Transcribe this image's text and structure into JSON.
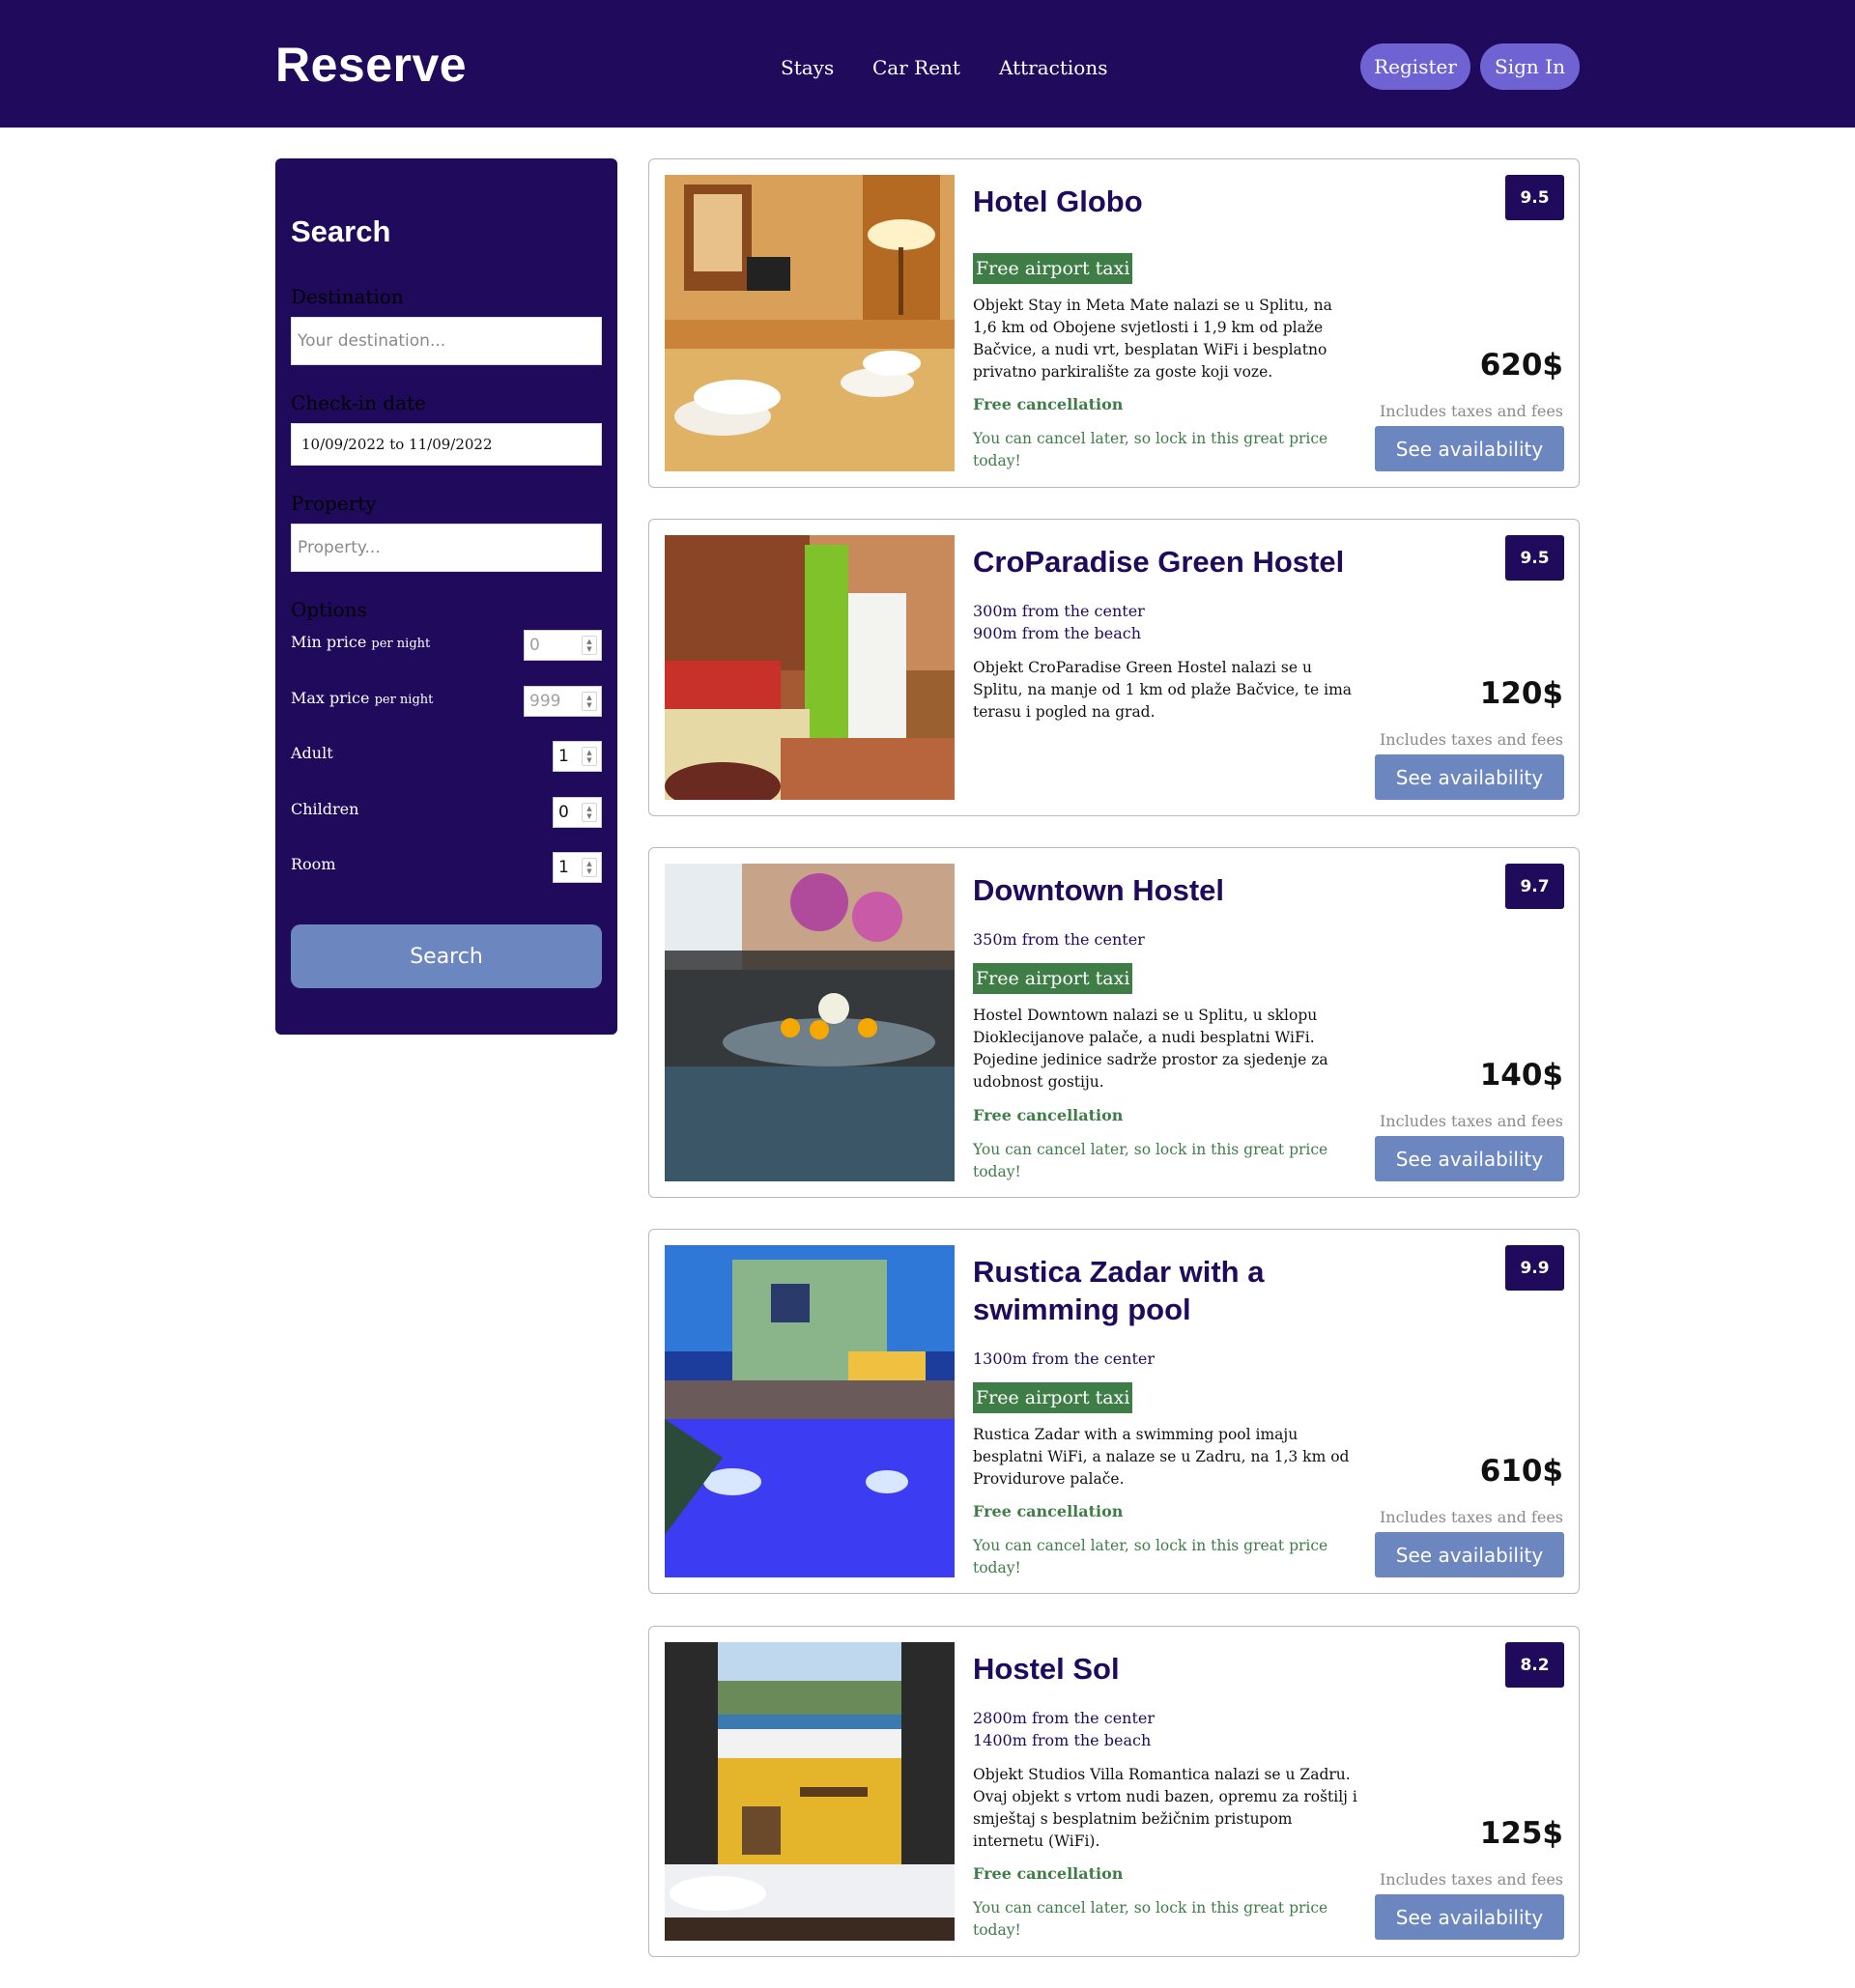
{
  "header": {
    "logo": "Reserve",
    "nav": [
      "Stays",
      "Car Rent",
      "Attractions"
    ],
    "register": "Register",
    "sign_in": "Sign In"
  },
  "sidebar": {
    "title": "Search",
    "destination_label": "Destination",
    "destination_placeholder": "Your destination...",
    "checkin_label": "Check-in date",
    "checkin_value": "10/09/2022 to 11/09/2022",
    "property_label": "Property",
    "property_placeholder": "Property...",
    "options_label": "Options",
    "min_price_label": "Min price",
    "min_price_suffix": "per night",
    "min_price_placeholder": "0",
    "max_price_label": "Max price",
    "max_price_suffix": "per night",
    "max_price_placeholder": "999",
    "adult_label": "Adult",
    "adult_value": "1",
    "children_label": "Children",
    "children_value": "0",
    "room_label": "Room",
    "room_value": "1",
    "search_button": "Search"
  },
  "results": [
    {
      "title": "Hotel Globo",
      "distance_center": "",
      "distance_beach": "",
      "taxi": "Free airport taxi",
      "description": "Objekt Stay in Meta Mate nalazi se u Splitu, na 1,6 km od Obojene svjetlosti i 1,9 km od plaže Bačvice, a nudi vrt, besplatan WiFi i besplatno privatno parkiralište za goste koji voze.",
      "free_cancellation": "Free cancellation",
      "cancel_note": "You can cancel later, so lock in this great price today!",
      "rating": "9.5",
      "price": "620$",
      "taxes": "Includes taxes and fees",
      "button": "See availability"
    },
    {
      "title": "CroParadise Green Hostel",
      "distance_center": "300m from the center",
      "distance_beach": "900m from the beach",
      "taxi": "",
      "description": "Objekt CroParadise Green Hostel nalazi se u Splitu, na manje od 1 km od plaže Bačvice, te ima terasu i pogled na grad.",
      "free_cancellation": "",
      "cancel_note": "",
      "rating": "9.5",
      "price": "120$",
      "taxes": "Includes taxes and fees",
      "button": "See availability"
    },
    {
      "title": "Downtown Hostel",
      "distance_center": "350m from the center",
      "distance_beach": "",
      "taxi": "Free airport taxi",
      "description": "Hostel Downtown nalazi se u Splitu, u sklopu Dioklecijanove palače, a nudi besplatni WiFi. Pojedine jedinice sadrže prostor za sjedenje za udobnost gostiju.",
      "free_cancellation": "Free cancellation",
      "cancel_note": "You can cancel later, so lock in this great price today!",
      "rating": "9.7",
      "price": "140$",
      "taxes": "Includes taxes and fees",
      "button": "See availability"
    },
    {
      "title": "Rustica Zadar with a swimming pool",
      "distance_center": "1300m from the center",
      "distance_beach": "",
      "taxi": "Free airport taxi",
      "description": "Rustica Zadar with a swimming pool imaju besplatni WiFi, a nalaze se u Zadru, na 1,3 km od Providurove palače.",
      "free_cancellation": "Free cancellation",
      "cancel_note": "You can cancel later, so lock in this great price today!",
      "rating": "9.9",
      "price": "610$",
      "taxes": "Includes taxes and fees",
      "button": "See availability"
    },
    {
      "title": "Hostel Sol",
      "distance_center": "2800m from the center",
      "distance_beach": "1400m from the beach",
      "taxi": "",
      "description": "Objekt Studios Villa Romantica nalazi se u Zadru. Ovaj objekt s vrtom nudi bazen, opremu za roštilj i smještaj s besplatnim bežičnim pristupom internetu (WiFi).",
      "free_cancellation": "Free cancellation",
      "cancel_note": "You can cancel later, so lock in this great price today!",
      "rating": "8.2",
      "price": "125$",
      "taxes": "Includes taxes and fees",
      "button": "See availability"
    }
  ]
}
